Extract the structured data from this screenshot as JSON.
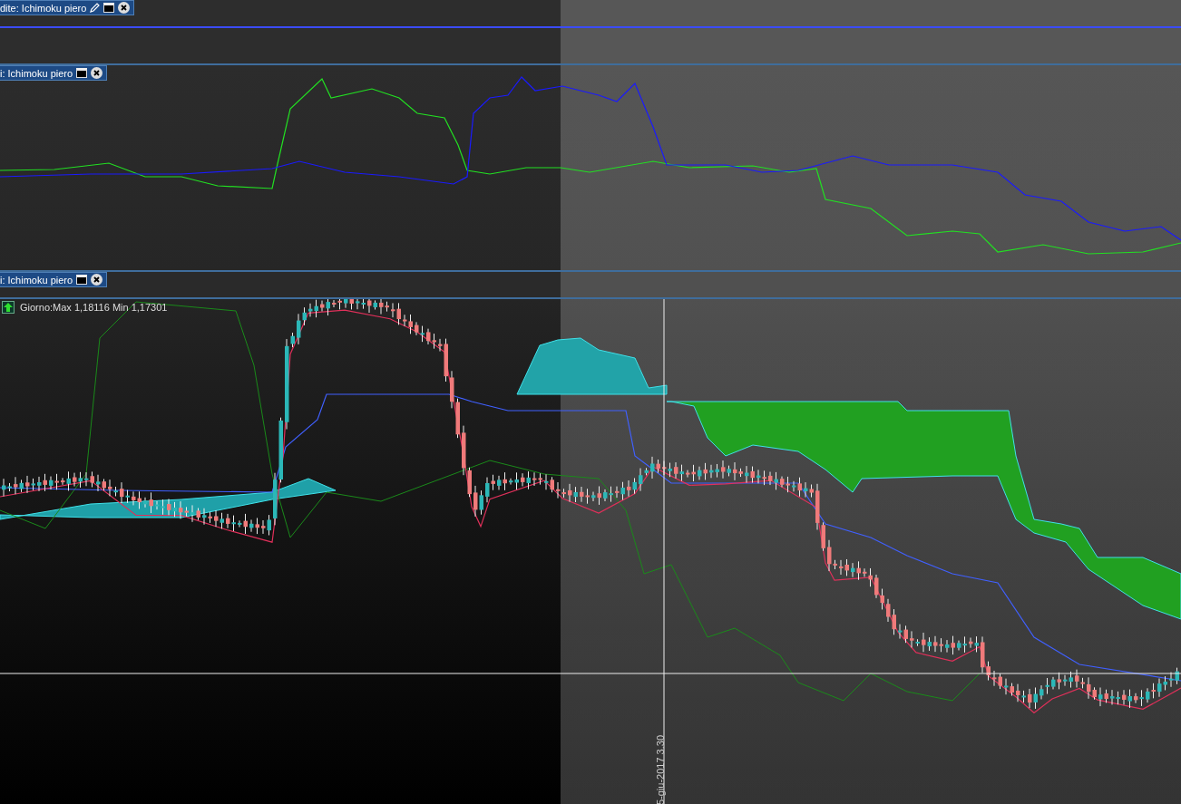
{
  "panes": [
    {
      "kind": "flat",
      "label": "dite: Ichimoku piero",
      "edit_icon": true
    },
    {
      "kind": "lines",
      "label": "i: Ichimoku piero",
      "edit_icon": false
    },
    {
      "kind": "candles",
      "label": "i: Ichimoku piero",
      "edit_icon": false,
      "legend": "Giorno:Max 1,18116 Min 1,17301"
    }
  ],
  "crosshair": {
    "date_label": "5-giu-2017 3.30"
  }
}
